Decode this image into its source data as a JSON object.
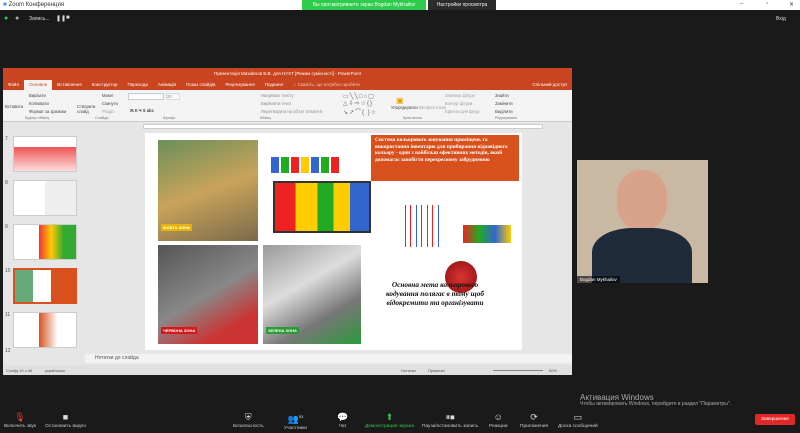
{
  "zoom": {
    "window_title": "Zoom Конференция",
    "share_message": "Вы просматриваете экран Bogdan Mykhailov",
    "view_options": "Настройки просмотра",
    "recording": "Запись...",
    "exit_fullscreen": "Вхід",
    "participant_name": "Bogdan Mykhailov",
    "participant_count": "53",
    "toolbar": [
      {
        "label": "Включить звук",
        "icon": "mic-muted-icon"
      },
      {
        "label": "Остановить видео",
        "icon": "video-icon"
      },
      {
        "label": "Безопасность",
        "icon": "shield-icon"
      },
      {
        "label": "Участники",
        "icon": "participants-icon"
      },
      {
        "label": "Чат",
        "icon": "chat-icon"
      },
      {
        "label": "Демонстрация экрана",
        "icon": "share-screen-icon"
      },
      {
        "label": "Пауза/остановить запись",
        "icon": "pause-stop-icon"
      },
      {
        "label": "Реакции",
        "icon": "reactions-icon"
      },
      {
        "label": "Приложения",
        "icon": "apps-icon"
      },
      {
        "label": "Доска сообщений",
        "icon": "whiteboard-icon"
      }
    ],
    "end_label": "Завершение"
  },
  "windows": {
    "activate_title": "Активация Windows",
    "activate_sub": "Чтобы активировать Windows, перейдите в раздел \"Параметры\"."
  },
  "ppt": {
    "title": "Презентація Михайлов Б.В. для НУХТ [Режим сумісності] - PowerPoint",
    "tabs": [
      "Файл",
      "Основне",
      "Вставлення",
      "Конструктор",
      "Переходи",
      "Анімація",
      "Показ слайдів",
      "Рецензування",
      "Подання",
      "♀ Скажіть, що потрібно зробити"
    ],
    "share": "Спільний доступ",
    "ribbon": {
      "paste": "Вставити",
      "cut": "Вирізати",
      "copy": "Копіювати",
      "format_painter": "Формат за зразком",
      "new_slide": "Створити слайд",
      "layout": "Макет",
      "reset": "Скинути",
      "section": "Розділ",
      "arrange": "Упорядкувати",
      "quick_styles": "Експрес-стилі",
      "fill": "Заливка фігури",
      "outline": "Контур фігури",
      "effects": "Ефекти для фігур",
      "find": "Знайти",
      "replace": "Замінити",
      "select": "Виділити",
      "text_dir": "Напрямок тексту",
      "align_text": "Вирівняти текст",
      "smartart": "Перетворити на об'єкт SmartArt",
      "font_size": "20",
      "groups": [
        "Буфер обміну",
        "Слайди",
        "Шрифт",
        "Абзац",
        "Креслення",
        "Редагування"
      ]
    },
    "thumbs": [
      "7",
      "8",
      "9",
      "10",
      "11",
      "12"
    ],
    "notes": "Нотатки до слайда",
    "status": {
      "slide": "Слайд 10 з 46",
      "lang": "українська",
      "notes": "Нотатки",
      "comments": "Примітки",
      "zoom": "60%"
    },
    "slide": {
      "title": "Система кольорового зонування приміщень та використання інвентарю для прибирання відповідного кольору - один з найбільш ефективних методів, який допомагає запобігти перехресному забрудненню",
      "goal": "Основна мета кольорового кодування полягає в тому щоб відокремити та організувати",
      "zones": [
        {
          "label": "ЖОВТА ЗОНА",
          "color": "#e8b400"
        },
        {
          "label": "ЧЕРВОНА ЗОНА",
          "color": "#d11b1b"
        },
        {
          "label": "ЗЕЛЕНА ЗОНА",
          "color": "#2c9a3a"
        }
      ]
    }
  }
}
